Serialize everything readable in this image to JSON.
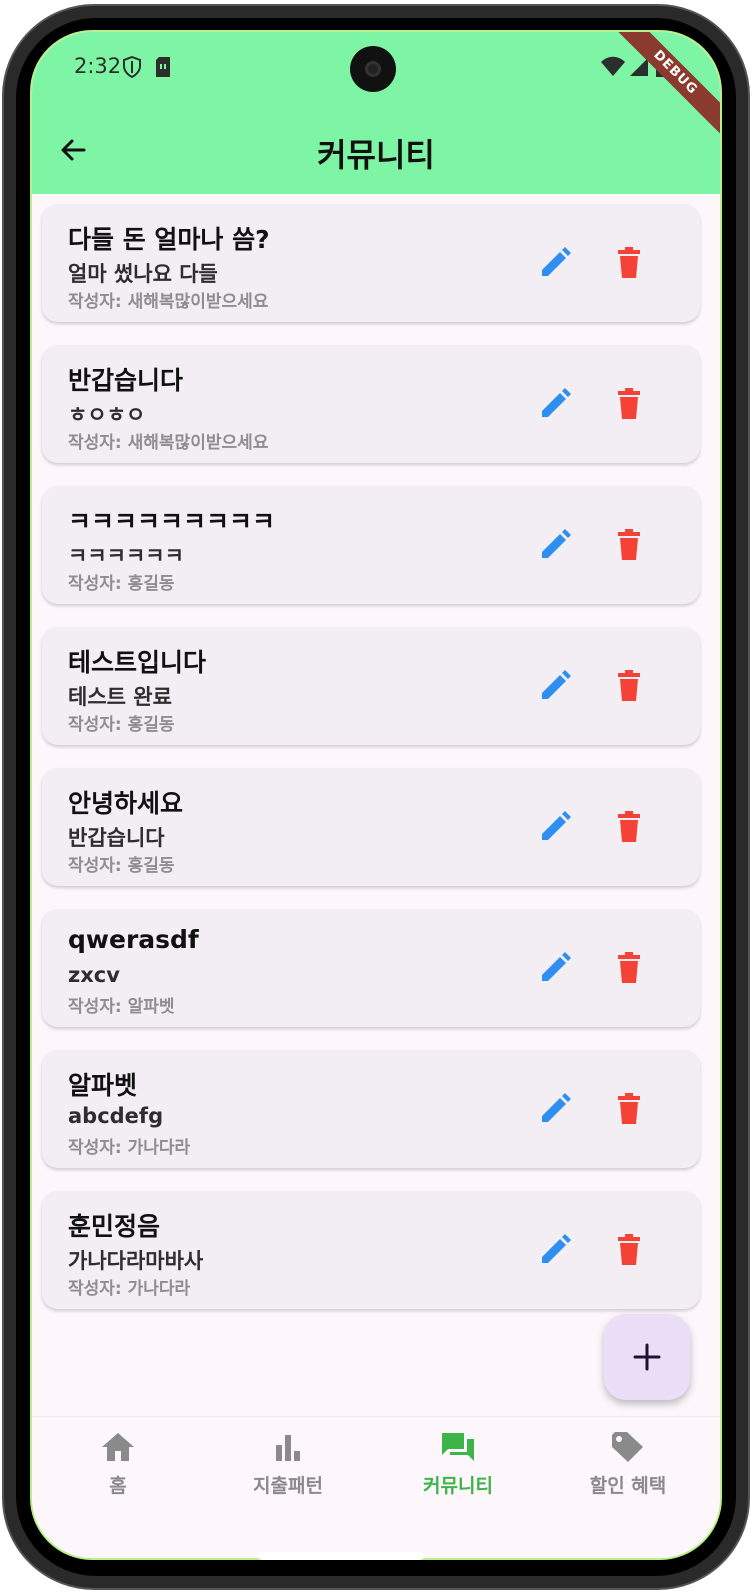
{
  "status_bar": {
    "time": "2:32"
  },
  "debug_banner": "DEBUG",
  "appbar": {
    "title": "커뮤니티"
  },
  "posts": [
    {
      "title": "다들 돈 얼마나 씀?",
      "body": "얼마 썼나요 다들",
      "author": "작성자: 새해복많이받으세요"
    },
    {
      "title": "반갑습니다",
      "body": "ㅎㅇㅎㅇ",
      "author": "작성자: 새해복많이받으세요"
    },
    {
      "title": "ㅋㅋㅋㅋㅋㅋㅋㅋㅋ",
      "body": "ㅋㅋㅋㅋㅋㅋ",
      "author": "작성자: 홍길동"
    },
    {
      "title": "테스트입니다",
      "body": "테스트 완료",
      "author": "작성자: 홍길동"
    },
    {
      "title": "안녕하세요",
      "body": "반갑습니다",
      "author": "작성자: 홍길동"
    },
    {
      "title": "qwerasdf",
      "body": "zxcv",
      "author": "작성자: 알파벳"
    },
    {
      "title": "알파벳",
      "body": "abcdefg",
      "author": "작성자: 가나다라"
    },
    {
      "title": "훈민정음",
      "body": "가나다라마바사",
      "author": "작성자: 가나다라"
    }
  ],
  "nav": [
    {
      "label": "홈",
      "icon": "home-icon"
    },
    {
      "label": "지출패턴",
      "icon": "bar-chart-icon"
    },
    {
      "label": "커뮤니티",
      "icon": "forum-icon"
    },
    {
      "label": "할인 혜택",
      "icon": "tag-icon"
    }
  ],
  "colors": {
    "appbar": "#7ef5a4",
    "edit": "#2f8ff0",
    "delete": "#f44336",
    "nav_active": "#3cb44a",
    "nav_inactive": "#8a8a8a",
    "fab_bg": "#ebdff8"
  }
}
